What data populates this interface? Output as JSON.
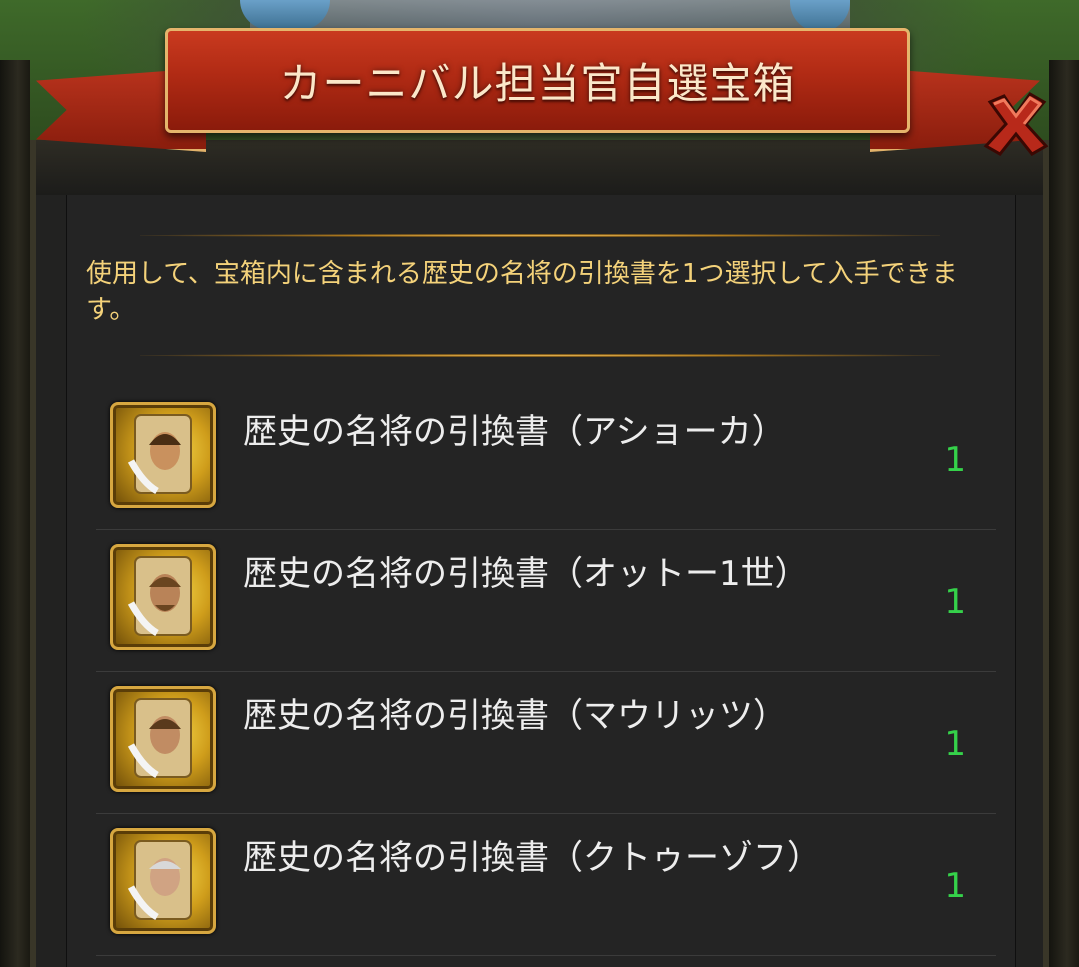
{
  "header": {
    "title": "カーニバル担当官自選宝箱"
  },
  "description": "使用して、宝箱内に含まれる歴史の名将の引換書を1つ選択して入手できます。",
  "items": [
    {
      "name": "歴史の名将の引換書（アショーカ）",
      "count": "1",
      "icon": "scroll-portrait-icon"
    },
    {
      "name": "歴史の名将の引換書（オットー1世）",
      "count": "1",
      "icon": "scroll-portrait-icon"
    },
    {
      "name": "歴史の名将の引換書（マウリッツ）",
      "count": "1",
      "icon": "scroll-portrait-icon"
    },
    {
      "name": "歴史の名将の引換書（クトゥーゾフ）",
      "count": "1",
      "icon": "scroll-portrait-icon"
    }
  ],
  "colors": {
    "ribbon": "#b02a14",
    "ribbon_border": "#e5b56c",
    "description_text": "#f4d27a",
    "count_text": "#35d14a",
    "panel_bg": "#242424"
  }
}
